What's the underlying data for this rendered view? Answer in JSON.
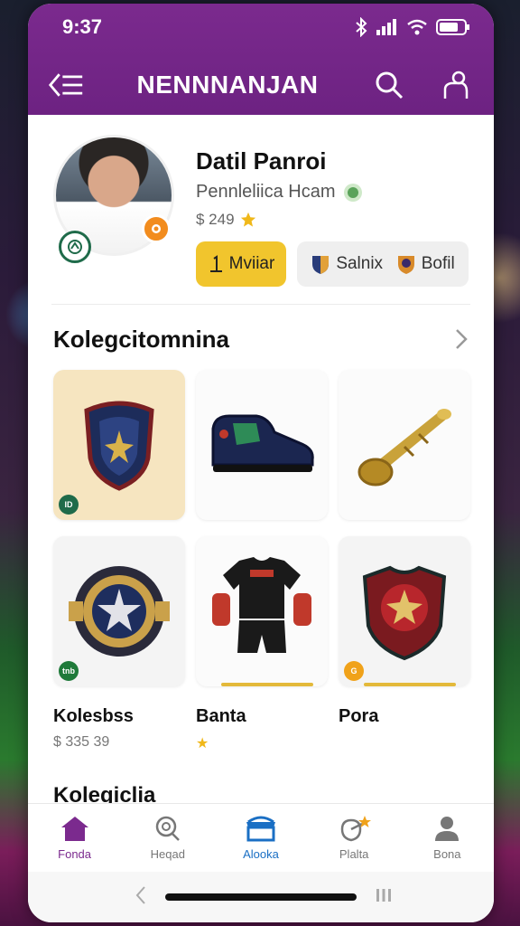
{
  "status": {
    "time": "9:37"
  },
  "header": {
    "title": "NENNNANJAN"
  },
  "profile": {
    "name": "Datil Panroi",
    "subtitle": "Pennleliica Hcam",
    "coins": "$ 249",
    "primary_button": "Mviiar",
    "secondary_buttons": [
      "Salnix",
      "Bofil"
    ]
  },
  "collection": {
    "title": "Kolegcitomnina",
    "cards": [
      {
        "icon": "shield-chestplate-icon",
        "background": "cream",
        "badge": "ID",
        "badge_color": "#1f6b4a"
      },
      {
        "icon": "boot-icon",
        "background": "white"
      },
      {
        "icon": "horn-icon",
        "background": "white"
      },
      {
        "icon": "medal-badge-icon",
        "background": "grey",
        "badge": "tnb",
        "badge_color": "#1f7a3a"
      },
      {
        "icon": "jersey-kit-icon",
        "background": "grey",
        "bar": true
      },
      {
        "icon": "armor-shield-icon",
        "background": "grey",
        "badge": "G",
        "badge_color": "#f0a21a",
        "bar": true
      }
    ],
    "labels": [
      {
        "title": "Kolesbss",
        "sub": "$ 335 39"
      },
      {
        "title": "Banta",
        "sub": "★"
      },
      {
        "title": "Pora",
        "sub": ""
      }
    ]
  },
  "next_section": {
    "title": "Kolegiclia"
  },
  "tabs": [
    {
      "label": "Fonda",
      "icon": "home-icon",
      "state": "active-purple"
    },
    {
      "label": "Heqad",
      "icon": "search-icon",
      "state": ""
    },
    {
      "label": "Alooka",
      "icon": "shop-icon",
      "state": "active-blue"
    },
    {
      "label": "Plalta",
      "icon": "trophy-icon",
      "state": ""
    },
    {
      "label": "Bona",
      "icon": "profile-icon",
      "state": ""
    }
  ],
  "colors": {
    "brand": "#7b2a8e",
    "accent": "#f1c52d",
    "active_tab_blue": "#1a6fc4"
  }
}
